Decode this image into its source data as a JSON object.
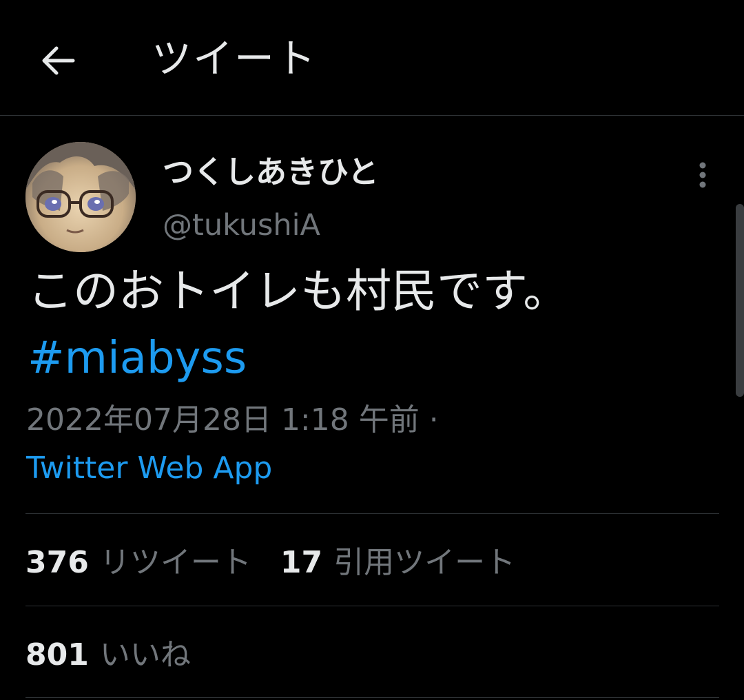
{
  "header": {
    "title": "ツイート",
    "back_icon": "arrow-left-icon"
  },
  "author": {
    "display_name": "つくしあきひと",
    "handle": "@tukushiA",
    "avatar": "avatar-image"
  },
  "tweet": {
    "text": "このおトイレも村民です。",
    "hashtag": "#miabyss",
    "timestamp": "2022年07月28日 1:18 午前",
    "separator": "·",
    "source": "Twitter Web App"
  },
  "stats": {
    "retweets": {
      "count": "376",
      "label": "リツイート"
    },
    "quotes": {
      "count": "17",
      "label": "引用ツイート"
    },
    "likes": {
      "count": "801",
      "label": "いいね"
    }
  },
  "colors": {
    "background": "#000000",
    "text_primary": "#e7e9ea",
    "text_secondary": "#71767b",
    "accent": "#1d9bf0",
    "divider": "#2f3336"
  }
}
